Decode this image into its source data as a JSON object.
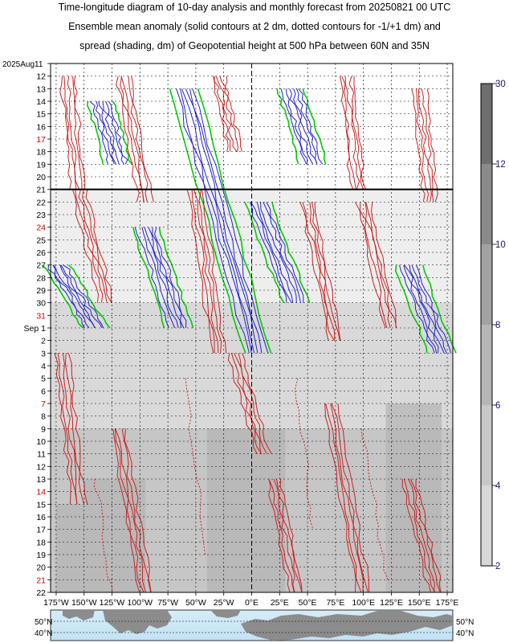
{
  "chart_data": {
    "type": "heatmap",
    "title_lines": [
      "Time-longitude diagram of 10-day analysis and monthly forecast from 20250821 00 UTC",
      "Ensemble mean anomaly (solid contours at 2 dm, dotted contours for -1/+1 dm) and",
      "spread (shading, dm) of Geopotential height at 500 hPa between 60N and 35N"
    ],
    "x_ticks": [
      "175°W",
      "150°W",
      "125°W",
      "100°W",
      "75°W",
      "50°W",
      "25°W",
      "0°E",
      "25°E",
      "50°E",
      "75°E",
      "100°E",
      "125°E",
      "150°E",
      "175°E"
    ],
    "x_tick_values": [
      -175,
      -150,
      -125,
      -100,
      -75,
      -50,
      -25,
      0,
      25,
      50,
      75,
      100,
      125,
      150,
      175
    ],
    "xlim": [
      -180,
      180
    ],
    "y_ticks": [
      {
        "label": "2025Aug11",
        "day": 11,
        "color": "#000000"
      },
      {
        "label": "12",
        "day": 12,
        "color": "#000000"
      },
      {
        "label": "13",
        "day": 13,
        "color": "#000000"
      },
      {
        "label": "14",
        "day": 14,
        "color": "#000000"
      },
      {
        "label": "15",
        "day": 15,
        "color": "#000000"
      },
      {
        "label": "16",
        "day": 16,
        "color": "#000000"
      },
      {
        "label": "17",
        "day": 17,
        "color": "#cc0000"
      },
      {
        "label": "18",
        "day": 18,
        "color": "#000000"
      },
      {
        "label": "19",
        "day": 19,
        "color": "#000000"
      },
      {
        "label": "20",
        "day": 20,
        "color": "#000000"
      },
      {
        "label": "21",
        "day": 21,
        "color": "#000000"
      },
      {
        "label": "22",
        "day": 22,
        "color": "#000000"
      },
      {
        "label": "23",
        "day": 23,
        "color": "#000000"
      },
      {
        "label": "24",
        "day": 24,
        "color": "#cc0000"
      },
      {
        "label": "25",
        "day": 25,
        "color": "#000000"
      },
      {
        "label": "26",
        "day": 26,
        "color": "#000000"
      },
      {
        "label": "27",
        "day": 27,
        "color": "#000000"
      },
      {
        "label": "28",
        "day": 28,
        "color": "#000000"
      },
      {
        "label": "29",
        "day": 29,
        "color": "#000000"
      },
      {
        "label": "30",
        "day": 30,
        "color": "#000000"
      },
      {
        "label": "31",
        "day": 31,
        "color": "#cc0000"
      },
      {
        "label": "Sep  1",
        "day": 32,
        "color": "#000000"
      },
      {
        "label": "2",
        "day": 33,
        "color": "#000000"
      },
      {
        "label": "3",
        "day": 34,
        "color": "#000000"
      },
      {
        "label": "4",
        "day": 35,
        "color": "#000000"
      },
      {
        "label": "5",
        "day": 36,
        "color": "#000000"
      },
      {
        "label": "6",
        "day": 37,
        "color": "#000000"
      },
      {
        "label": "7",
        "day": 38,
        "color": "#cc0000"
      },
      {
        "label": "8",
        "day": 39,
        "color": "#000000"
      },
      {
        "label": "9",
        "day": 40,
        "color": "#000000"
      },
      {
        "label": "10",
        "day": 41,
        "color": "#000000"
      },
      {
        "label": "11",
        "day": 42,
        "color": "#000000"
      },
      {
        "label": "12",
        "day": 43,
        "color": "#000000"
      },
      {
        "label": "13",
        "day": 44,
        "color": "#000000"
      },
      {
        "label": "14",
        "day": 45,
        "color": "#cc0000"
      },
      {
        "label": "15",
        "day": 46,
        "color": "#000000"
      },
      {
        "label": "16",
        "day": 47,
        "color": "#000000"
      },
      {
        "label": "17",
        "day": 48,
        "color": "#000000"
      },
      {
        "label": "18",
        "day": 49,
        "color": "#000000"
      },
      {
        "label": "19",
        "day": 50,
        "color": "#000000"
      },
      {
        "label": "20",
        "day": 51,
        "color": "#000000"
      },
      {
        "label": "21",
        "day": 52,
        "color": "#cc0000"
      },
      {
        "label": "22",
        "day": 53,
        "color": "#000000"
      }
    ],
    "ylim_days": [
      11,
      53
    ],
    "analysis_forecast_boundary_day": 21,
    "colorbar": {
      "ticks": [
        "30",
        "12",
        "10",
        "8",
        "6",
        "4",
        "2"
      ],
      "tick_values": [
        30,
        12,
        10,
        8,
        6,
        4,
        2
      ],
      "shading": [
        "#6e6e6e",
        "#8a8a8a",
        "#a2a2a2",
        "#b6b6b6",
        "#c8c8c8",
        "#d8d8d8"
      ]
    },
    "map_labels": {
      "lat_top": "50°N",
      "lat_bottom": "40°N"
    },
    "colors": {
      "positive_anomaly": "#cc2222",
      "negative_anomaly": "#2222cc",
      "zero_contour": "#00cc00",
      "gridline": "#000000"
    },
    "spread_shading": [
      {
        "day_from": 11,
        "day_to": 21,
        "level": "<2"
      },
      {
        "day_from": 21,
        "day_to": 30,
        "level": "2-4"
      },
      {
        "day_from": 30,
        "day_to": 40,
        "level": "4-6"
      },
      {
        "day_from": 40,
        "day_to": 53,
        "level": "6-8"
      }
    ],
    "negative_anomaly_bands": [
      {
        "lon_start": -135,
        "day_start": 14,
        "lon_end": -120,
        "day_end": 19
      },
      {
        "lon_start": -60,
        "day_start": 13,
        "lon_end": 5,
        "day_end": 34
      },
      {
        "lon_start": -95,
        "day_start": 24,
        "lon_end": -65,
        "day_end": 32
      },
      {
        "lon_start": -175,
        "day_start": 27,
        "lon_end": -140,
        "day_end": 32
      },
      {
        "lon_start": 5,
        "day_start": 22,
        "lon_end": 40,
        "day_end": 30
      },
      {
        "lon_start": 35,
        "day_start": 13,
        "lon_end": 55,
        "day_end": 19
      },
      {
        "lon_start": 140,
        "day_start": 27,
        "lon_end": 170,
        "day_end": 34
      }
    ]
  }
}
